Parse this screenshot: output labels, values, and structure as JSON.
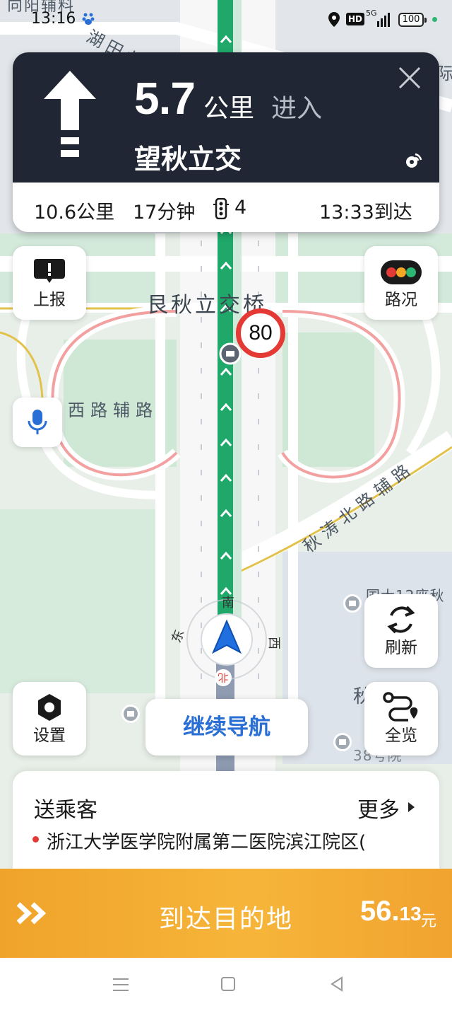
{
  "status_bar": {
    "time": "13:16",
    "network_label": "HD",
    "signal_label": "5G",
    "battery": "100"
  },
  "map": {
    "labels": {
      "top_road_partial": "向阳辅料",
      "road_hutian": "湖田北路",
      "bridge": "艮秋立交桥",
      "west_aux_road": "西路辅路",
      "qiutao_aux_road": "秋涛北路辅路",
      "top_right_partial": "际",
      "right_poi_partial": "国大12座秋",
      "bottom_right_poi_partial": "秋",
      "bottom_right_number": "38号院"
    },
    "compass": {
      "south": "南",
      "east": "东",
      "west": "西",
      "north": "北"
    },
    "speed_limit": "80"
  },
  "nav_card": {
    "distance": "5.7",
    "distance_unit": "公里",
    "action": "进入",
    "next_road": "望秋立交",
    "total_distance": "10.6公里",
    "total_time": "17分钟",
    "traffic_lights": "4",
    "arrival": "13:33到达"
  },
  "buttons": {
    "report": "上报",
    "traffic": "路况",
    "refresh": "刷新",
    "settings": "设置",
    "overview": "全览",
    "continue_nav": "继续导航"
  },
  "passenger": {
    "title": "送乘客",
    "more": "更多",
    "destination": "浙江大学医学院附属第二医院滨江院区("
  },
  "arrive_bar": {
    "label": "到达目的地",
    "fare_integer": "56.",
    "fare_decimal": "13",
    "fare_unit": "元"
  },
  "colors": {
    "route_green": "#1fa86a",
    "nav_dark": "#202633",
    "arrive_orange": "#f3aa33",
    "accent_blue": "#2a6fd6"
  }
}
